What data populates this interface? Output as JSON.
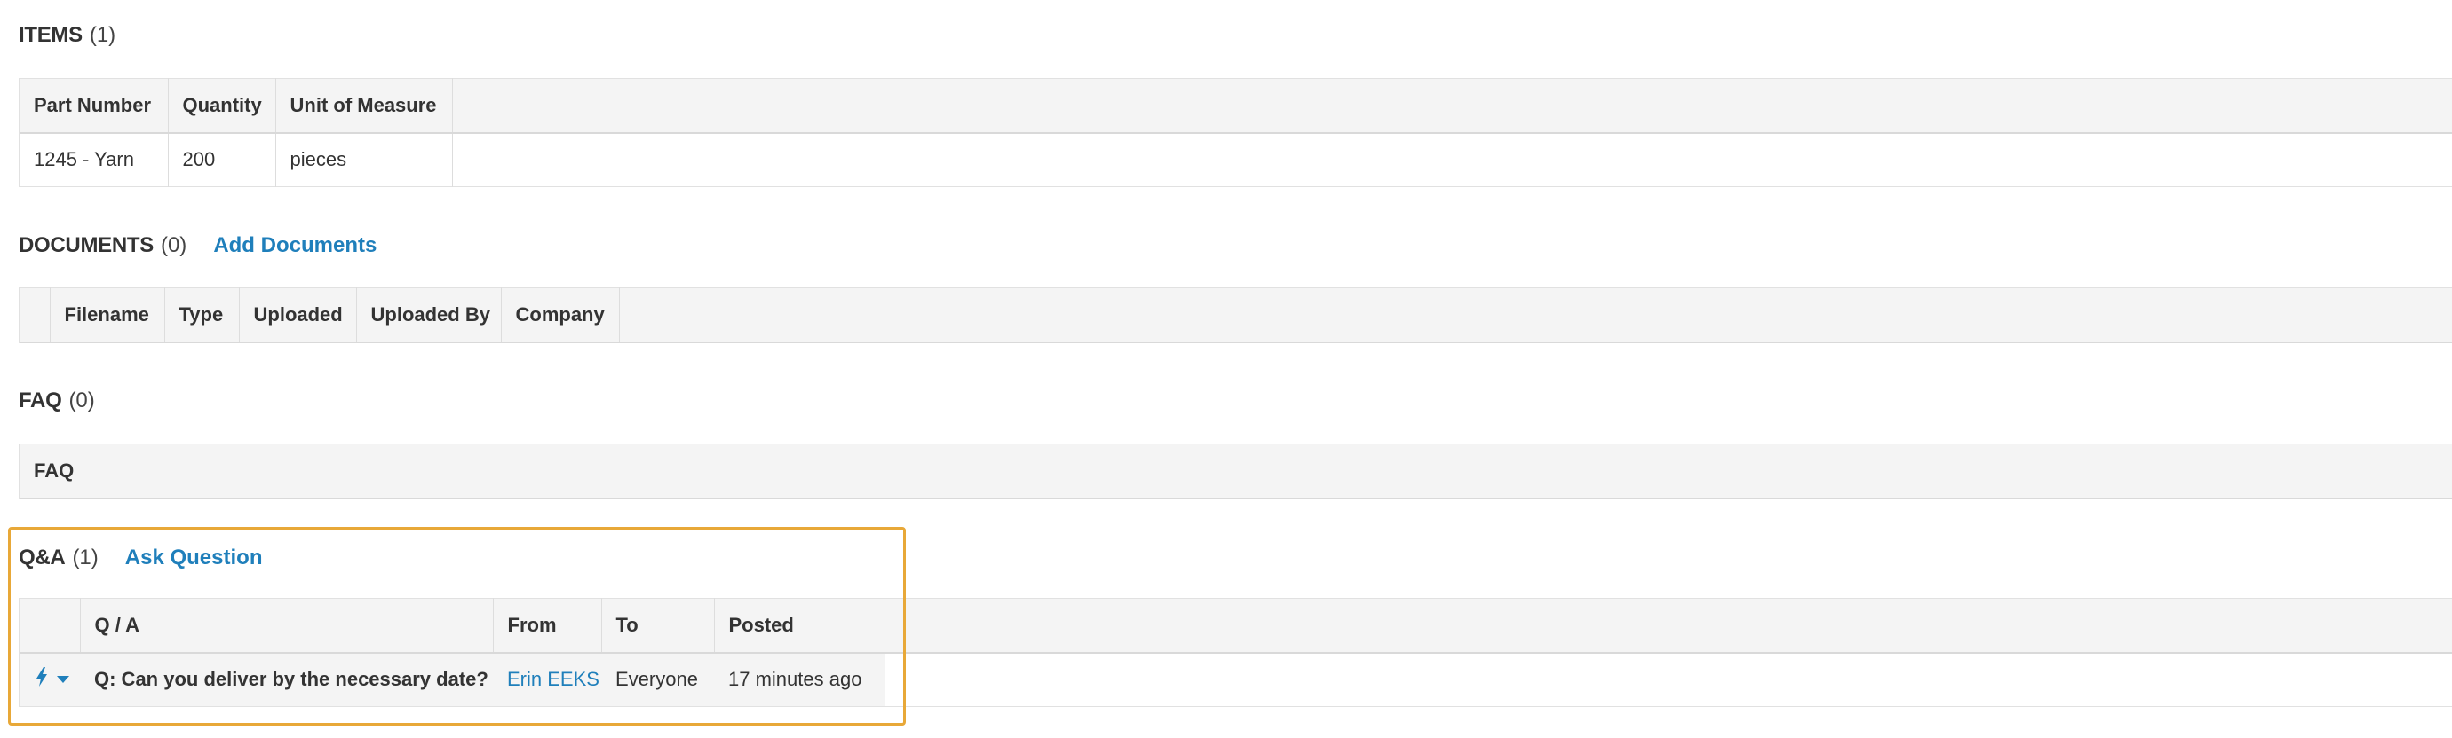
{
  "items": {
    "title": "ITEMS",
    "count": "(1)",
    "columns": [
      "Part Number",
      "Quantity",
      "Unit of Measure",
      ""
    ],
    "rows": [
      [
        "1245 - Yarn",
        "200",
        "pieces",
        ""
      ]
    ]
  },
  "documents": {
    "title": "DOCUMENTS",
    "count": "(0)",
    "action_label": "Add Documents",
    "columns": [
      "",
      "Filename",
      "Type",
      "Uploaded",
      "Uploaded By",
      "Company",
      ""
    ]
  },
  "faq": {
    "title": "FAQ",
    "count": "(0)",
    "columns": [
      "FAQ"
    ]
  },
  "qa": {
    "title": "Q&A",
    "count": "(1)",
    "action_label": "Ask Question",
    "columns": [
      "",
      "Q / A",
      "From",
      "To",
      "Posted",
      ""
    ],
    "rows": [
      {
        "action_icon": "bolt-icon",
        "question": "Q: Can you deliver by the necessary date?",
        "from": "Erin EEKS",
        "to": "Everyone",
        "posted": "17 minutes ago"
      }
    ]
  },
  "colors": {
    "link": "#1f7fbb",
    "highlight": "#e8a838",
    "header_bg": "#f4f4f4"
  }
}
